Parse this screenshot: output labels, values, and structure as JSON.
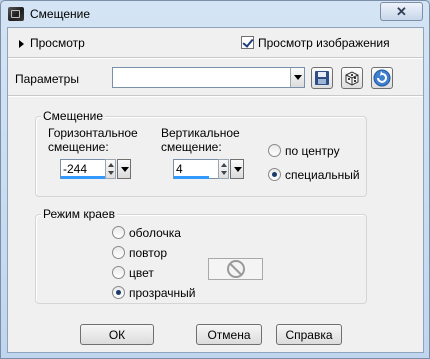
{
  "window": {
    "title": "Смещение",
    "close_label": "✕"
  },
  "preview": {
    "toggle_label": "Просмотр",
    "checkbox_label": "Просмотр изображения",
    "checkbox_checked": true
  },
  "params": {
    "label": "Параметры",
    "value": "",
    "icons": [
      "save-preset-icon",
      "random-dice-icon",
      "reset-icon"
    ]
  },
  "offset": {
    "group_label": "Смещение",
    "horizontal_label": "Горизонтальное смещение:",
    "horizontal_value": "-244",
    "vertical_label": "Вертикальное смещение:",
    "vertical_value": "4",
    "options": [
      {
        "label": "по центру",
        "selected": false
      },
      {
        "label": "специальный",
        "selected": true
      }
    ]
  },
  "edge_mode": {
    "group_label": "Режим краев",
    "options": [
      {
        "label": "оболочка",
        "selected": false
      },
      {
        "label": "повтор",
        "selected": false
      },
      {
        "label": "цвет",
        "selected": false
      },
      {
        "label": "прозрачный",
        "selected": true
      }
    ],
    "color_icon": "no-color-icon"
  },
  "buttons": {
    "ok": "ОК",
    "cancel": "Отмена",
    "help": "Справка"
  },
  "colors": {
    "accent": "#3399ff",
    "window_frame": "#c0d6ee",
    "client_bg": "#f0f0f0"
  }
}
